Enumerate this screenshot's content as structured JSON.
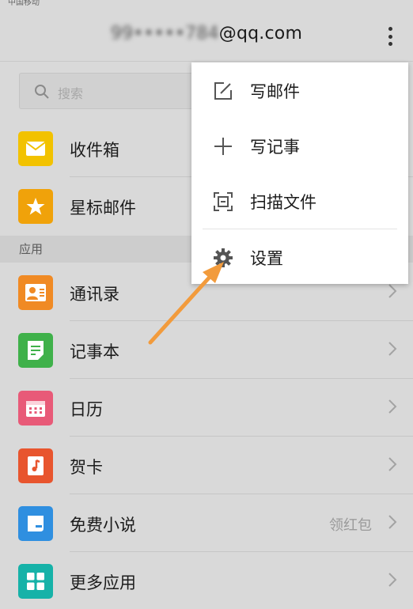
{
  "status_bar": {
    "carrier": "中国移动"
  },
  "header": {
    "account_blurred": "99•••••784",
    "account_domain": "@qq.com"
  },
  "search": {
    "placeholder": "搜索"
  },
  "mail_items": [
    {
      "label": "收件箱",
      "icon": "envelope-icon",
      "color": "#f2c200"
    },
    {
      "label": "星标邮件",
      "icon": "star-icon",
      "color": "#f0a20a"
    }
  ],
  "section": {
    "apps_label": "应用"
  },
  "app_items": [
    {
      "label": "通讯录",
      "icon": "contacts-icon",
      "color": "#f08a24"
    },
    {
      "label": "记事本",
      "icon": "notepad-icon",
      "color": "#3fb14a"
    },
    {
      "label": "日历",
      "icon": "calendar-icon",
      "color": "#e85a78"
    },
    {
      "label": "贺卡",
      "icon": "greeting-card-icon",
      "color": "#e8552e"
    },
    {
      "label": "免费小说",
      "icon": "novel-icon",
      "color": "#2f8fe0",
      "extra": "领红包"
    },
    {
      "label": "更多应用",
      "icon": "grid-icon",
      "color": "#16b2a8"
    }
  ],
  "menu": {
    "items": [
      {
        "label": "写邮件",
        "icon": "edit-icon"
      },
      {
        "label": "写记事",
        "icon": "plus-icon"
      },
      {
        "label": "扫描文件",
        "icon": "scan-icon"
      },
      {
        "label": "设置",
        "icon": "gear-icon"
      }
    ]
  },
  "annotation": {
    "arrow_color": "#f29b3c"
  }
}
